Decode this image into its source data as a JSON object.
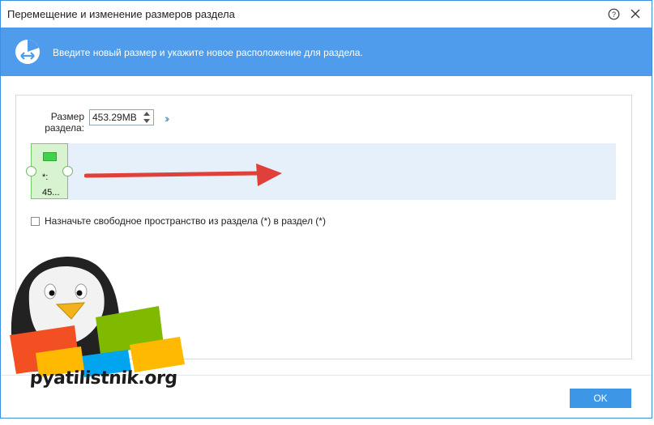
{
  "window": {
    "title": "Перемещение и изменение размеров раздела",
    "help_icon": "help-icon",
    "close_icon": "close-icon"
  },
  "banner": {
    "icon": "partition-resize-icon",
    "text": "Введите новый размер и укажите новое расположение для раздела.",
    "color": "#4e9ceb"
  },
  "size": {
    "label_line1": "Размер",
    "label_line2": "раздела:",
    "value": "453.29MB",
    "expand_icon": "double-chevron-right-icon"
  },
  "partition": {
    "letter": "*:",
    "size_short": "45...",
    "color": "#43d04a"
  },
  "annotation": {
    "arrow_color": "#e0403a"
  },
  "checkbox": {
    "label": "Назначьте свободное пространство из раздела (*) в раздел (*)",
    "checked": false
  },
  "footer": {
    "ok_label": "OK"
  },
  "watermark": {
    "text": "pyatilistnik.org"
  }
}
